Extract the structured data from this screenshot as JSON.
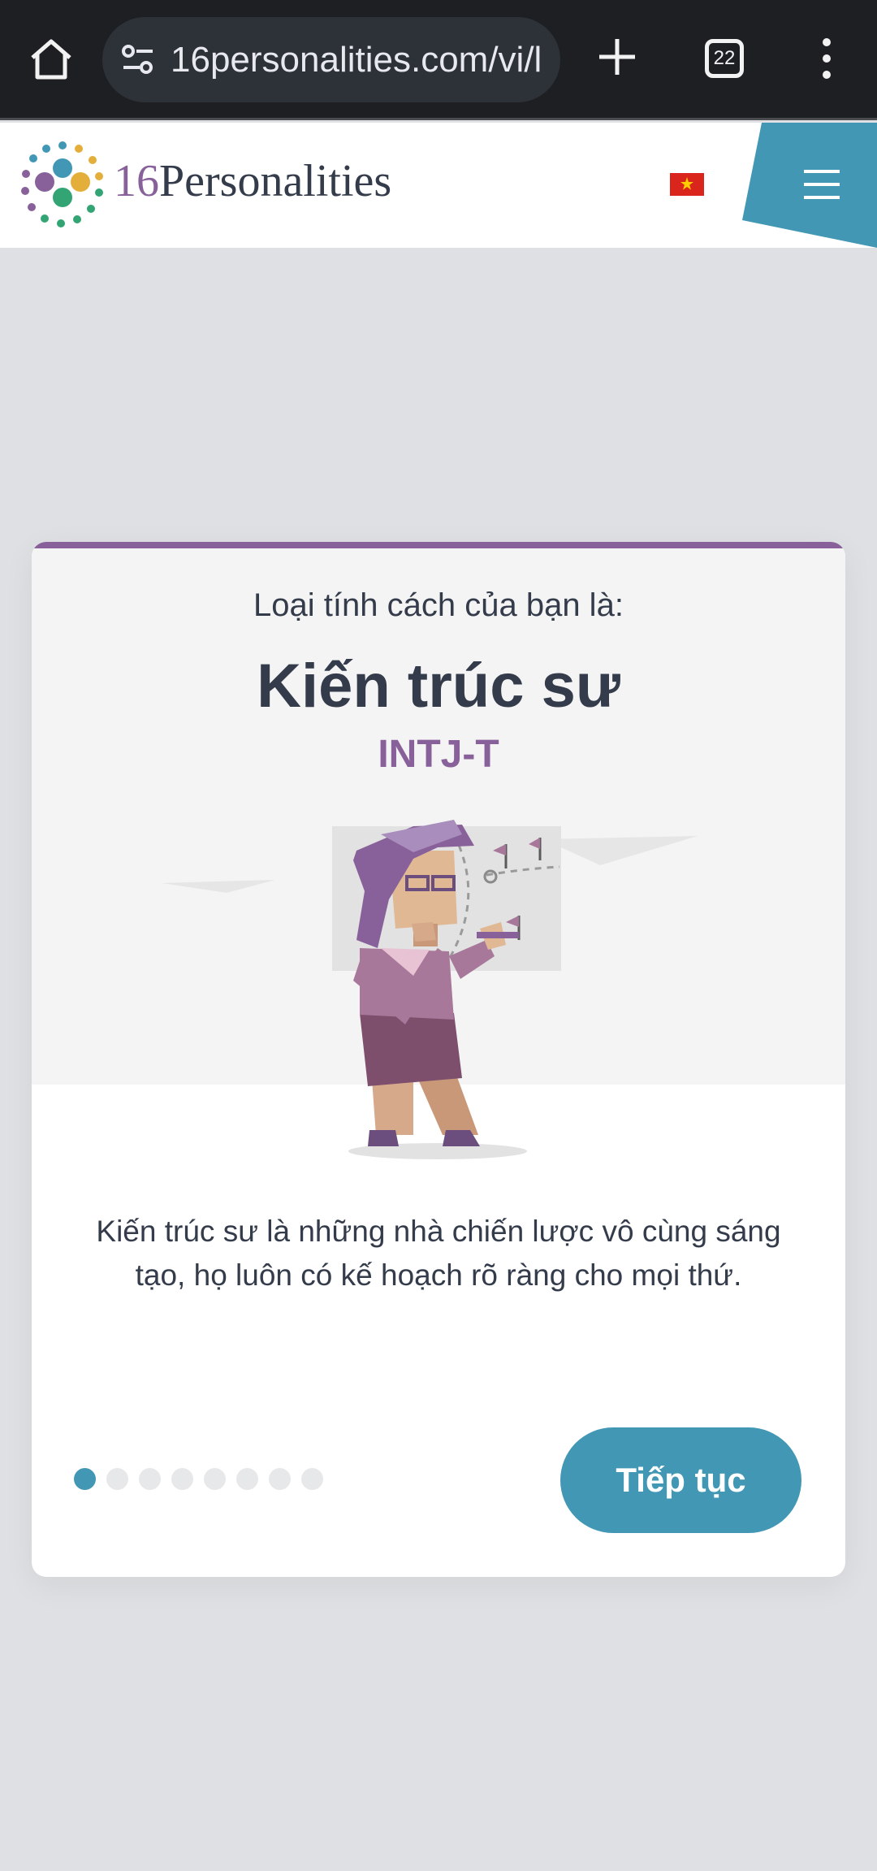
{
  "browser": {
    "url": "16personalities.com/vi/l",
    "tab_count": "22",
    "icons": [
      "home-icon",
      "site-settings-icon",
      "new-tab-icon",
      "tab-switcher-icon",
      "more-options-icon"
    ]
  },
  "header": {
    "brand_number": "16",
    "brand_name": "Personalities",
    "language_flag": "vietnam-flag-icon",
    "menu_icon": "hamburger-menu-icon"
  },
  "card": {
    "subtitle": "Loại tính cách của bạn là:",
    "type_name": "Kiến trúc sư",
    "type_code": "INTJ-T",
    "description": "Kiến trúc sư là những nhà chiến lược vô cùng sáng tạo, họ luôn có kế hoạch rõ ràng cho mọi thứ.",
    "progress": {
      "total_steps": 8,
      "current_step": 1
    },
    "continue_label": "Tiếp tục"
  },
  "colors": {
    "accent_purple": "#88619a",
    "accent_blue": "#4298b4",
    "text_dark": "#343c4b",
    "page_bg": "#dfe0e3"
  }
}
